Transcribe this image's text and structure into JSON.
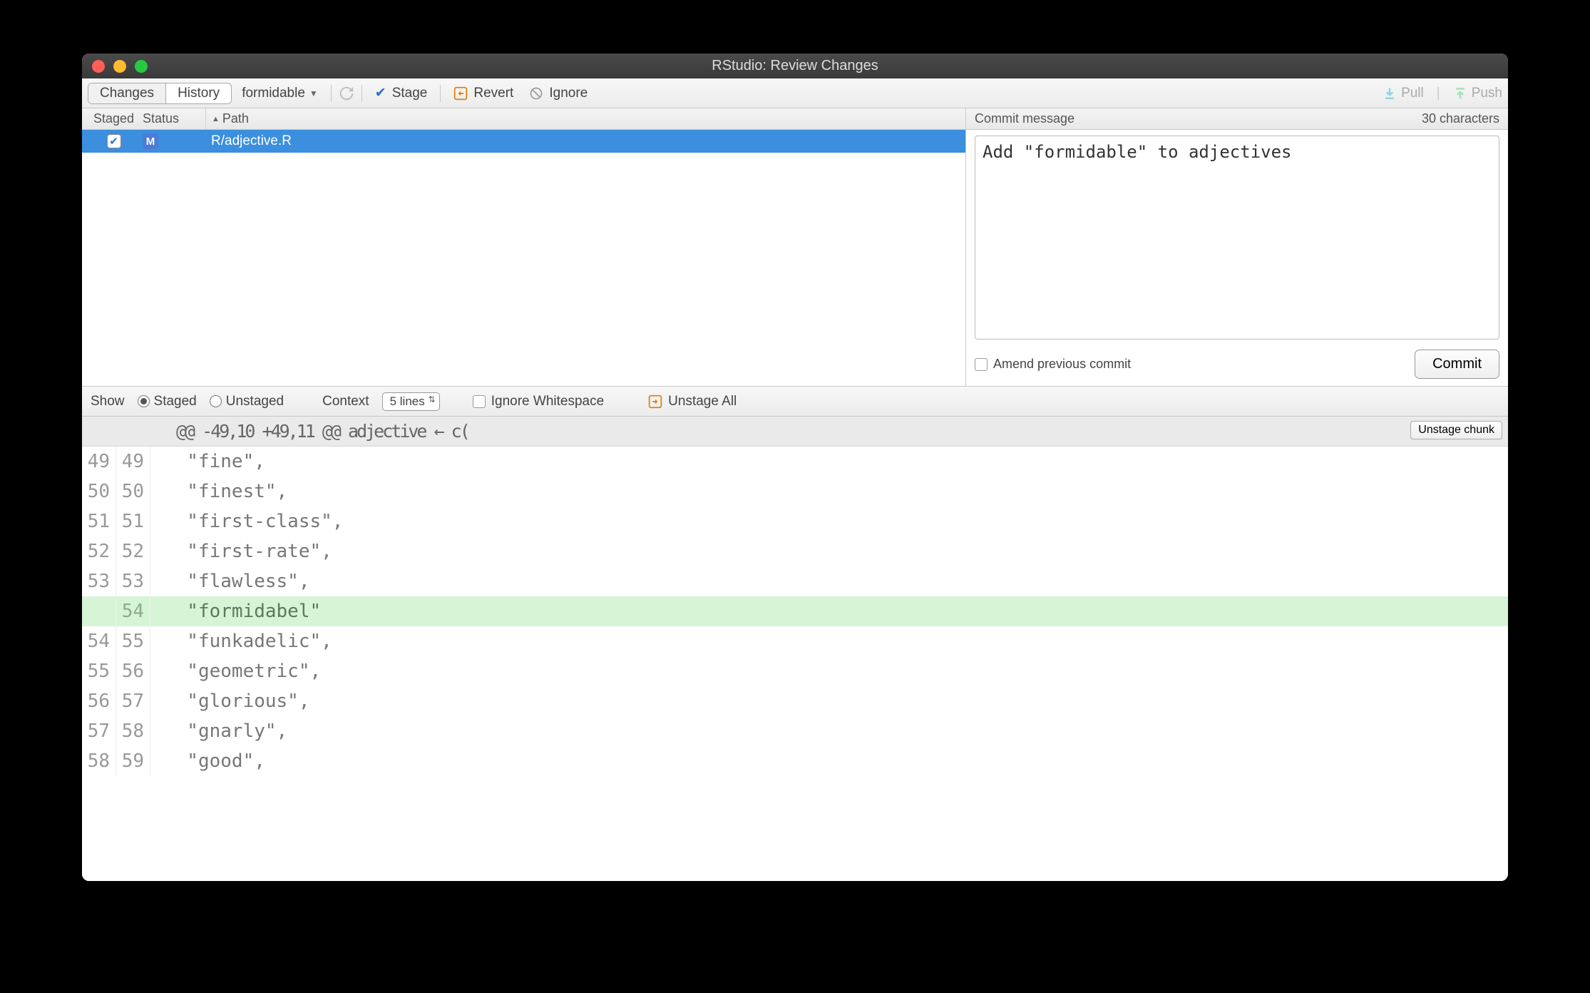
{
  "window": {
    "title": "RStudio: Review Changes"
  },
  "toolbar": {
    "changes": "Changes",
    "history": "History",
    "branch": "formidable",
    "stage": "Stage",
    "revert": "Revert",
    "ignore": "Ignore",
    "pull": "Pull",
    "push": "Push"
  },
  "filelist": {
    "headers": {
      "staged": "Staged",
      "status": "Status",
      "path": "Path"
    },
    "rows": [
      {
        "staged": true,
        "status": "M",
        "path": "R/adjective.R"
      }
    ]
  },
  "commit": {
    "label": "Commit message",
    "count": "30 characters",
    "message": "Add \"formidable\" to adjectives",
    "amend": "Amend previous commit",
    "button": "Commit"
  },
  "difftoolbar": {
    "show": "Show",
    "staged": "Staged",
    "unstaged": "Unstaged",
    "context": "Context",
    "context_value": "5 lines",
    "ignore_ws": "Ignore Whitespace",
    "unstage_all": "Unstage All"
  },
  "diff": {
    "hunk_header": "@@ -49,10 +49,11 @@ adjective ← c(",
    "unstage_chunk": "Unstage chunk",
    "lines": [
      {
        "old": "49",
        "new": "49",
        "type": "ctx",
        "text": "  \"fine\","
      },
      {
        "old": "50",
        "new": "50",
        "type": "ctx",
        "text": "  \"finest\","
      },
      {
        "old": "51",
        "new": "51",
        "type": "ctx",
        "text": "  \"first-class\","
      },
      {
        "old": "52",
        "new": "52",
        "type": "ctx",
        "text": "  \"first-rate\","
      },
      {
        "old": "53",
        "new": "53",
        "type": "ctx",
        "text": "  \"flawless\","
      },
      {
        "old": "",
        "new": "54",
        "type": "added",
        "text": "  \"formidabel\""
      },
      {
        "old": "54",
        "new": "55",
        "type": "ctx",
        "text": "  \"funkadelic\","
      },
      {
        "old": "55",
        "new": "56",
        "type": "ctx",
        "text": "  \"geometric\","
      },
      {
        "old": "56",
        "new": "57",
        "type": "ctx",
        "text": "  \"glorious\","
      },
      {
        "old": "57",
        "new": "58",
        "type": "ctx",
        "text": "  \"gnarly\","
      },
      {
        "old": "58",
        "new": "59",
        "type": "ctx",
        "text": "  \"good\","
      }
    ]
  }
}
